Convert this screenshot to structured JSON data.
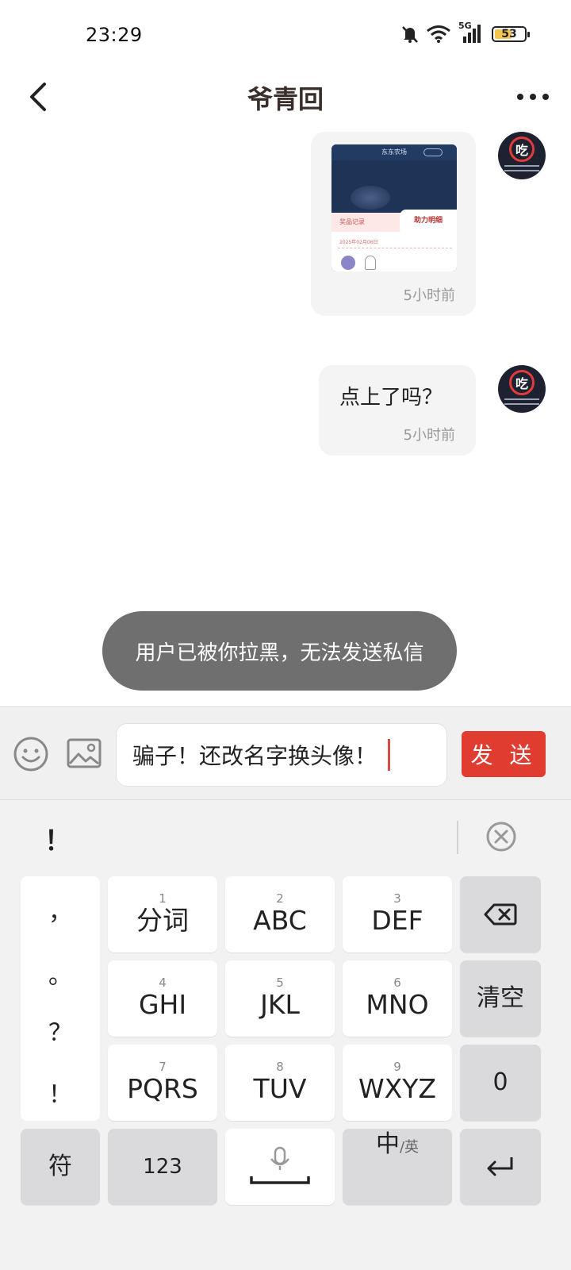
{
  "status_bar": {
    "time": "23:29",
    "network": "5G",
    "battery": "53"
  },
  "header": {
    "title": "爷青回"
  },
  "messages": [
    {
      "type": "image",
      "timestamp": "5小时前",
      "screenshot": {
        "title": "东东农场",
        "follow": "关注",
        "tab_record": "奖品记录",
        "tab_help": "助力明细",
        "date": "2025年02月06日"
      }
    },
    {
      "type": "text",
      "text": "点上了吗？",
      "timestamp": "5小时前"
    }
  ],
  "toast": "用户已被你拉黑，无法发送私信",
  "input": {
    "value": "骗子！还改名字换头像！",
    "send_label": "发 送"
  },
  "keyboard": {
    "candidate": "！",
    "punctuation": [
      "，",
      "。",
      "？",
      "！"
    ],
    "keys": [
      {
        "num": "1",
        "label": "分词"
      },
      {
        "num": "2",
        "label": "ABC"
      },
      {
        "num": "3",
        "label": "DEF"
      },
      {
        "num": "4",
        "label": "GHI"
      },
      {
        "num": "5",
        "label": "JKL"
      },
      {
        "num": "6",
        "label": "MNO"
      },
      {
        "num": "7",
        "label": "PQRS"
      },
      {
        "num": "8",
        "label": "TUV"
      },
      {
        "num": "9",
        "label": "WXYZ"
      }
    ],
    "clear": "清空",
    "zero": "0",
    "symbols": "符",
    "numbers": "123",
    "lang_main": "中",
    "lang_sub": "/英"
  },
  "colors": {
    "send": "#e03c2f",
    "toast": "#6f6f6f",
    "caret": "#d94b45"
  }
}
